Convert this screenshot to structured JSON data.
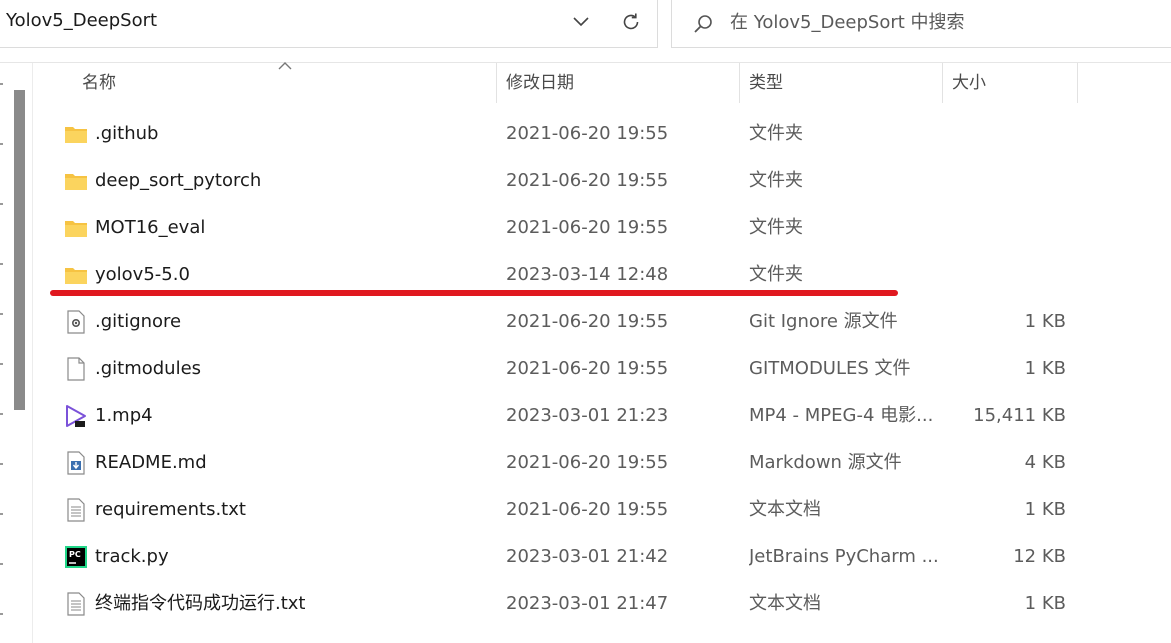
{
  "address": {
    "path": "Yolov5_DeepSort"
  },
  "search": {
    "placeholder": "在 Yolov5_DeepSort 中搜索"
  },
  "columns": {
    "name": "名称",
    "date": "修改日期",
    "type": "类型",
    "size": "大小"
  },
  "files": [
    {
      "name": ".github",
      "date": "2021-06-20 19:55",
      "type": "文件夹",
      "size": "",
      "icon": "folder-icon"
    },
    {
      "name": "deep_sort_pytorch",
      "date": "2021-06-20 19:55",
      "type": "文件夹",
      "size": "",
      "icon": "folder-icon"
    },
    {
      "name": "MOT16_eval",
      "date": "2021-06-20 19:55",
      "type": "文件夹",
      "size": "",
      "icon": "folder-icon"
    },
    {
      "name": "yolov5-5.0",
      "date": "2023-03-14 12:48",
      "type": "文件夹",
      "size": "",
      "icon": "folder-icon"
    },
    {
      "name": ".gitignore",
      "date": "2021-06-20 19:55",
      "type": "Git Ignore 源文件",
      "size": "1 KB",
      "icon": "settings-file-icon"
    },
    {
      "name": ".gitmodules",
      "date": "2021-06-20 19:55",
      "type": "GITMODULES 文件",
      "size": "1 KB",
      "icon": "blank-file-icon"
    },
    {
      "name": "1.mp4",
      "date": "2023-03-01 21:23",
      "type": "MP4 - MPEG-4 电影...",
      "size": "15,411 KB",
      "icon": "video-file-icon"
    },
    {
      "name": "README.md",
      "date": "2021-06-20 19:55",
      "type": "Markdown 源文件",
      "size": "4 KB",
      "icon": "markdown-file-icon"
    },
    {
      "name": "requirements.txt",
      "date": "2021-06-20 19:55",
      "type": "文本文档",
      "size": "1 KB",
      "icon": "text-file-icon"
    },
    {
      "name": "track.py",
      "date": "2023-03-01 21:42",
      "type": "JetBrains PyCharm ...",
      "size": "12 KB",
      "icon": "pycharm-file-icon"
    },
    {
      "name": "终端指令代码成功运行.txt",
      "date": "2023-03-01 21:47",
      "type": "文本文档",
      "size": "1 KB",
      "icon": "text-file-icon"
    }
  ],
  "colors": {
    "annotation": "#e0181f",
    "folder": "#f6c343",
    "scrollbar": "#8a8a8a"
  }
}
